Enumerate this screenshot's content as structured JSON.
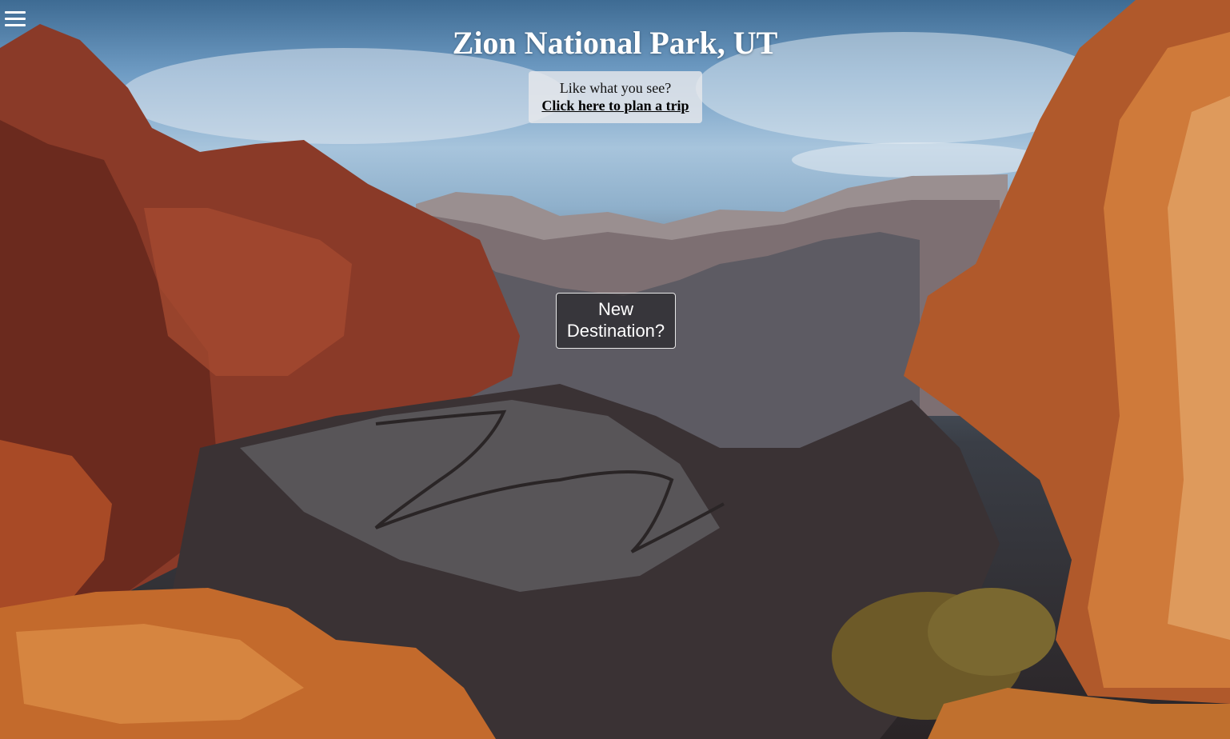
{
  "header": {
    "menu_icon": "hamburger-menu-icon",
    "title": "Zion National Park, UT"
  },
  "trip_prompt": {
    "question": "Like what you see?",
    "link_label": "Click here to plan a trip"
  },
  "actions": {
    "new_destination_line1": "New",
    "new_destination_line2": "Destination?"
  },
  "colors": {
    "title": "#ffffff",
    "prompt_background": "#e6e8eb",
    "button_background": "#28282c",
    "button_border": "#e8e8e8"
  }
}
